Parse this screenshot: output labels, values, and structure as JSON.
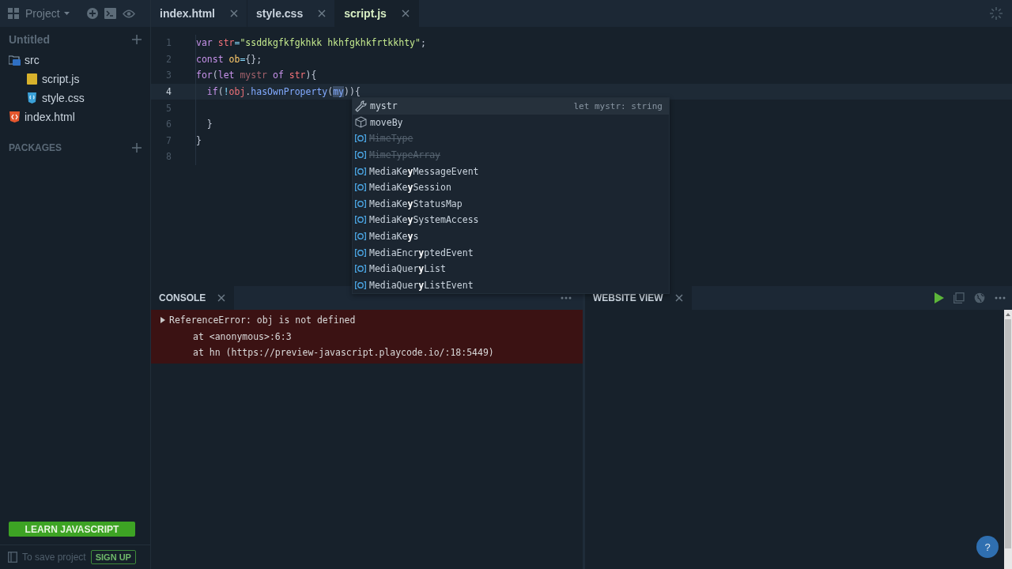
{
  "sidebar": {
    "project_menu": "Project",
    "project_name": "Untitled",
    "tree": [
      {
        "label": "src",
        "kind": "folder",
        "expanded": true,
        "children": [
          {
            "label": "script.js",
            "kind": "js"
          },
          {
            "label": "style.css",
            "kind": "css"
          }
        ]
      },
      {
        "label": "index.html",
        "kind": "html"
      }
    ],
    "packages_heading": "PACKAGES",
    "learn_button": "LEARN JAVASCRIPT",
    "save_hint": "To save project",
    "signup_button": "SIGN UP"
  },
  "tabs": [
    {
      "label": "index.html",
      "selected": false
    },
    {
      "label": "style.css",
      "selected": false
    },
    {
      "label": "script.js",
      "selected": true
    }
  ],
  "editor": {
    "lines": [
      {
        "number": "1",
        "active": false,
        "tokens": [
          {
            "text": "var ",
            "kind": "keyword"
          },
          {
            "text": "str",
            "kind": "variable"
          },
          {
            "text": "=",
            "kind": "operator"
          },
          {
            "text": "\"ssddkgfkfgkhkk hkhfgkhkfrtkkhty\"",
            "kind": "string"
          },
          {
            "text": ";",
            "kind": "plain"
          }
        ]
      },
      {
        "number": "2",
        "active": false,
        "tokens": [
          {
            "text": "const ",
            "kind": "keyword"
          },
          {
            "text": "ob",
            "kind": "constant"
          },
          {
            "text": "=",
            "kind": "operator"
          },
          {
            "text": "{};",
            "kind": "plain"
          }
        ]
      },
      {
        "number": "3",
        "active": false,
        "tokens": [
          {
            "text": "for",
            "kind": "keyword"
          },
          {
            "text": "(",
            "kind": "plain"
          },
          {
            "text": "let ",
            "kind": "keyword"
          },
          {
            "text": "mystr ",
            "kind": "unused"
          },
          {
            "text": "of ",
            "kind": "keyword"
          },
          {
            "text": "str",
            "kind": "variable"
          },
          {
            "text": "){",
            "kind": "plain"
          }
        ]
      },
      {
        "number": "4",
        "active": true,
        "tokens": [
          {
            "text": "  if",
            "kind": "keyword"
          },
          {
            "text": "(",
            "kind": "plain"
          },
          {
            "text": "!",
            "kind": "operator"
          },
          {
            "text": "obj",
            "kind": "variable"
          },
          {
            "text": ".",
            "kind": "plain"
          },
          {
            "text": "hasOwnProperty",
            "kind": "function"
          },
          {
            "text": "(",
            "kind": "plain"
          },
          {
            "text": "my",
            "kind": "selection"
          },
          {
            "text": ")){",
            "kind": "plain"
          }
        ]
      },
      {
        "number": "5",
        "active": false
      },
      {
        "number": "6",
        "active": false,
        "tokens": [
          {
            "text": "  }",
            "kind": "plain"
          }
        ]
      },
      {
        "number": "7",
        "active": false,
        "tokens": [
          {
            "text": "}",
            "kind": "plain"
          }
        ]
      },
      {
        "number": "8",
        "active": false
      }
    ],
    "suggestions": [
      {
        "label": "mystr",
        "kind": "variable",
        "deprecated": false,
        "selected": true,
        "detail": "let mystr: string"
      },
      {
        "label": "moveBy",
        "kind": "method",
        "deprecated": false,
        "selected": false
      },
      {
        "label": "MimeType",
        "kind": "class",
        "deprecated": true,
        "selected": false
      },
      {
        "label": "MimeTypeArray",
        "kind": "class",
        "deprecated": true,
        "selected": false
      },
      {
        "label": "MediaKe**y**MessageEvent",
        "kind": "class",
        "deprecated": false,
        "selected": false
      },
      {
        "label": "MediaKe**y**Session",
        "kind": "class",
        "deprecated": false,
        "selected": false
      },
      {
        "label": "MediaKe**y**StatusMap",
        "kind": "class",
        "deprecated": false,
        "selected": false
      },
      {
        "label": "MediaKe**y**SystemAccess",
        "kind": "class",
        "deprecated": false,
        "selected": false
      },
      {
        "label": "MediaKe**y**s",
        "kind": "class",
        "deprecated": false,
        "selected": false
      },
      {
        "label": "MediaEncr**y**ptedEvent",
        "kind": "class",
        "deprecated": false,
        "selected": false
      },
      {
        "label": "MediaQuer**y**List",
        "kind": "class",
        "deprecated": false,
        "selected": false
      },
      {
        "label": "MediaQuer**y**ListEvent",
        "kind": "class",
        "deprecated": false,
        "selected": false
      }
    ]
  },
  "console": {
    "tab": "CONSOLE",
    "entries": [
      {
        "kind": "error",
        "expanded": false,
        "message": "ReferenceError: obj is not defined",
        "stack": [
          "at <anonymous>:6:3",
          "at hn (https://preview-javascript.playcode.io/:18:5449)"
        ]
      }
    ]
  },
  "website_view": {
    "tab": "WEBSITE VIEW"
  },
  "help_button": "?"
}
